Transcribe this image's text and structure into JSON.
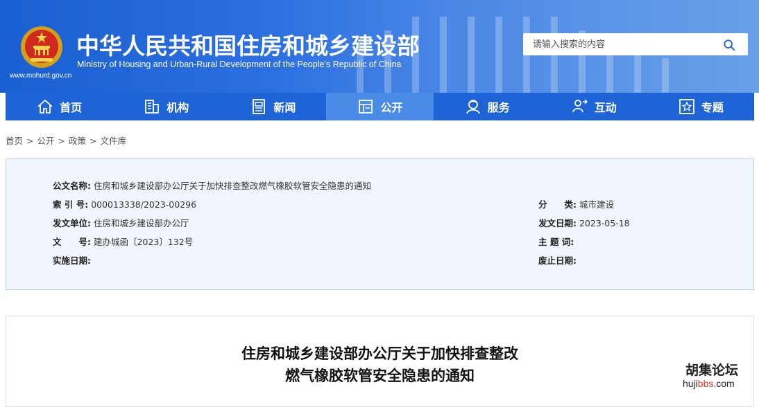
{
  "header": {
    "title_cn": "中华人民共和国住房和城乡建设部",
    "title_en": "Ministry of Housing and Urban-Rural Development of the People’s Republic of China",
    "site_url": "www.mohurd.gov.cn",
    "search_placeholder": "请输入搜索的内容",
    "brand_color": "#1e64d6"
  },
  "nav": {
    "items": [
      {
        "label": "首页",
        "icon": "home-icon"
      },
      {
        "label": "机构",
        "icon": "org-icon"
      },
      {
        "label": "新闻",
        "icon": "news-icon"
      },
      {
        "label": "公开",
        "icon": "public-icon",
        "active": true
      },
      {
        "label": "服务",
        "icon": "service-icon"
      },
      {
        "label": "互动",
        "icon": "interact-icon"
      },
      {
        "label": "专题",
        "icon": "topic-icon"
      }
    ]
  },
  "breadcrumb": [
    "首页",
    "公开",
    "政策",
    "文件库"
  ],
  "doc_info": {
    "name_label": "公文名称:",
    "name_value": "住房和城乡建设部办公厅关于加快排查整改燃气橡胶软管安全隐患的通知",
    "index_label": "索 引 号:",
    "index_value": "000013338/2023-00296",
    "category_label": "分　　类:",
    "category_value": "城市建设",
    "issuer_label": "发文单位:",
    "issuer_value": "住房和城乡建设部办公厅",
    "date_label": "发文日期:",
    "date_value": "2023-05-18",
    "docno_label": "文　　号:",
    "docno_value": "建办城函〔2023〕132号",
    "subject_label": "主 题 词:",
    "subject_value": "",
    "effective_label": "实施日期:",
    "effective_value": "",
    "expire_label": "废止日期:",
    "expire_value": ""
  },
  "article": {
    "title_line1": "住房和城乡建设部办公厅关于加快排查整改",
    "title_line2": "燃气橡胶软管安全隐患的通知"
  },
  "watermark": {
    "cn": "胡集论坛",
    "en_prefix": "huji",
    "en_highlight": "bbs",
    "en_suffix": ".com"
  }
}
